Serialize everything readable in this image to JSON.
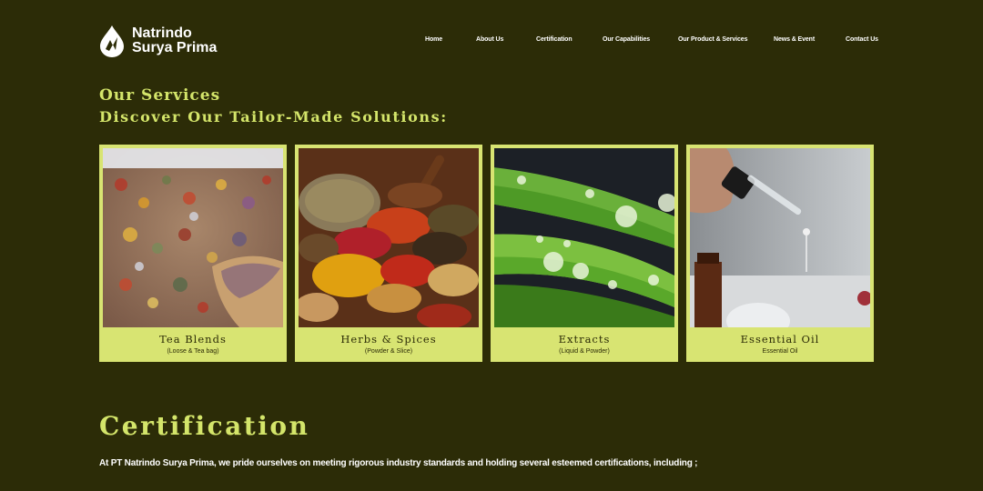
{
  "brand": {
    "line1": "Natrindo",
    "line2": "Surya Prima"
  },
  "nav": [
    "Home",
    "About Us",
    "Certification",
    "Our Capabilities",
    "Our Product & Services",
    "News & Event",
    "Contact Us"
  ],
  "services": {
    "title": "Our Services",
    "subtitle": "Discover Our Tailor-Made Solutions:",
    "cards": [
      {
        "title": "Tea Blends",
        "subtitle": "(Loose & Tea bag)",
        "image": "tea-blends-photo"
      },
      {
        "title": "Herbs & Spices",
        "subtitle": "(Powder & Slice)",
        "image": "herbs-spices-photo"
      },
      {
        "title": "Extracts",
        "subtitle": "(Liquid & Powder)",
        "image": "aloe-extract-photo"
      },
      {
        "title": "Essential Oil",
        "subtitle": "Essential Oil",
        "image": "essential-oil-dropper-photo"
      }
    ]
  },
  "certification": {
    "title": "Certification",
    "text": "At PT Natrindo Surya Prima, we pride ourselves on meeting rigorous industry standards and holding several esteemed certifications, including ;"
  },
  "colors": {
    "background": "#2c2c07",
    "accent": "#d4e56a",
    "card": "#d8e472"
  }
}
